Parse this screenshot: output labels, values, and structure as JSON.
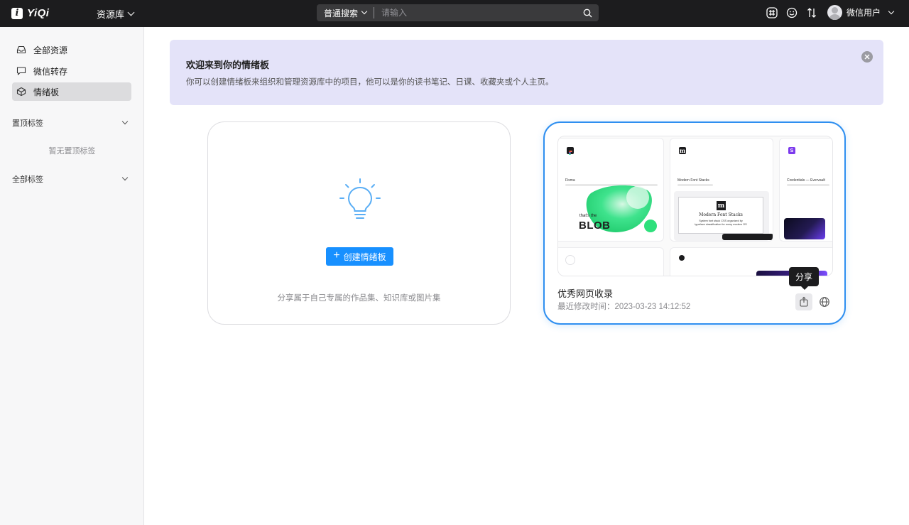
{
  "app": {
    "logo_text": "YiQi",
    "logo_mark": "i"
  },
  "header": {
    "library_label": "资源库",
    "search": {
      "type_label": "普通搜索",
      "placeholder": "请输入"
    },
    "user_name": "微信用户"
  },
  "sidebar": {
    "items": [
      {
        "label": "全部资源",
        "icon": "inbox-icon"
      },
      {
        "label": "微信转存",
        "icon": "chat-bubble-icon"
      },
      {
        "label": "情绪板",
        "icon": "cube-icon",
        "active": true
      }
    ],
    "pinned_tags": {
      "title": "置顶标签",
      "empty_text": "暂无置顶标签"
    },
    "all_tags": {
      "title": "全部标签"
    }
  },
  "banner": {
    "title": "欢迎来到你的情绪板",
    "description": "你可以创建情绪板来组织和管理资源库中的项目，他可以是你的读书笔记、日课、收藏夹或个人主页。"
  },
  "create_card": {
    "button_label": "创建情绪板",
    "hint": "分享属于自己专属的作品集、知识库或图片集"
  },
  "board_card": {
    "title": "优秀网页收录",
    "modified": "最近修改时间：2023-03-23 14:12:52",
    "tooltip": "分享",
    "preview_tiles": [
      {
        "title": "Fixma",
        "blob_small": "that's the",
        "blob_big": "BLOB"
      },
      {
        "title": "Modern Font Stacks",
        "logo": "m",
        "card_title": "Modern Font Stacks",
        "card_desc_1": "System font stack CSS organized by",
        "card_desc_2": "typeface classification for every modern OS"
      },
      {
        "title": "Credentials — Evervault"
      }
    ]
  },
  "colors": {
    "accent": "#1890ff",
    "board_border": "#2f8ff0",
    "banner_bg": "#e4e3f9",
    "topbar_bg": "#1c1c1e",
    "blob_green": "#2ee07c"
  }
}
